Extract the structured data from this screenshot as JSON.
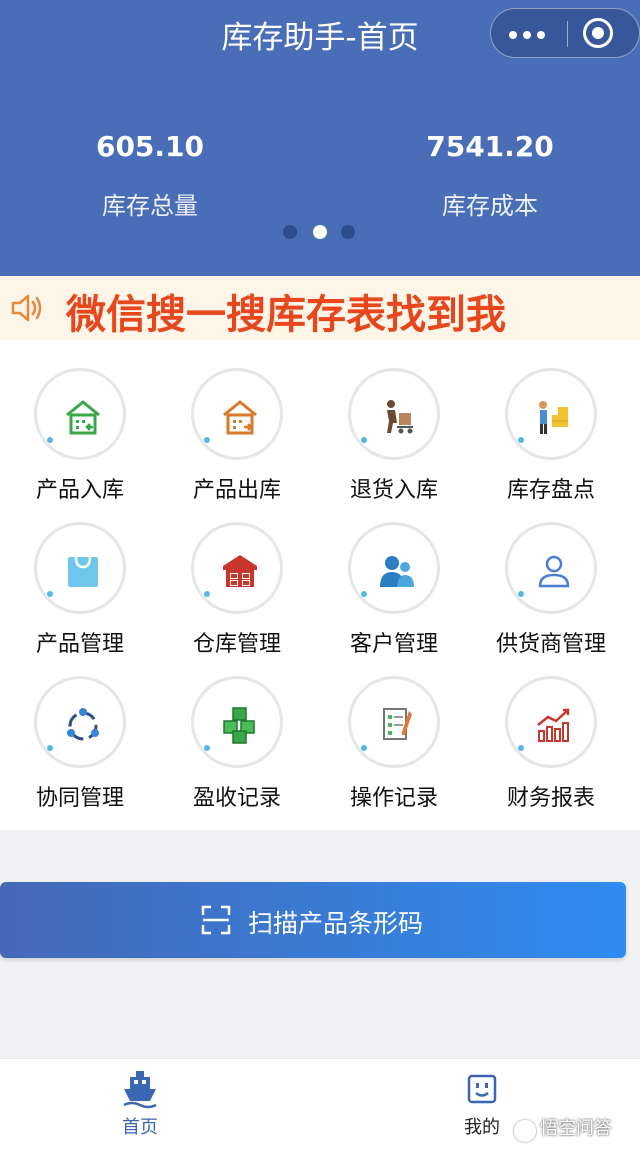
{
  "header": {
    "title": "库存助手-首页",
    "capsule": {
      "more_icon": "more-dots-icon",
      "close_icon": "target-circle-icon"
    }
  },
  "stats": [
    {
      "value": "605.10",
      "label": "库存总量"
    },
    {
      "value": "7541.20",
      "label": "库存成本"
    }
  ],
  "pager": {
    "count": 3,
    "active_index": 1
  },
  "notice": {
    "icon": "speaker-icon",
    "text": "微信搜一搜库存表找到我"
  },
  "menu": [
    {
      "label": "产品入库",
      "icon": "warehouse-in-icon"
    },
    {
      "label": "产品出库",
      "icon": "warehouse-out-icon"
    },
    {
      "label": "退货入库",
      "icon": "return-worker-icon"
    },
    {
      "label": "库存盘点",
      "icon": "inventory-check-icon"
    },
    {
      "label": "产品管理",
      "icon": "shopping-bag-icon"
    },
    {
      "label": "仓库管理",
      "icon": "warehouse-icon"
    },
    {
      "label": "客户管理",
      "icon": "customers-icon"
    },
    {
      "label": "供货商管理",
      "icon": "supplier-icon"
    },
    {
      "label": "协同管理",
      "icon": "collaboration-icon"
    },
    {
      "label": "盈收记录",
      "icon": "boxes-icon"
    },
    {
      "label": "操作记录",
      "icon": "document-edit-icon"
    },
    {
      "label": "财务报表",
      "icon": "bar-chart-icon"
    }
  ],
  "scan_button": {
    "label": "扫描产品条形码",
    "icon": "scan-icon"
  },
  "tabbar": {
    "home": {
      "label": "首页",
      "icon": "ship-home-icon"
    },
    "me": {
      "label": "我的",
      "icon": "face-icon"
    }
  },
  "watermark": "悟空问答",
  "colors": {
    "header_bg": "#4a6db8",
    "notice_text": "#e8471e",
    "accent": "#3b66b3"
  }
}
